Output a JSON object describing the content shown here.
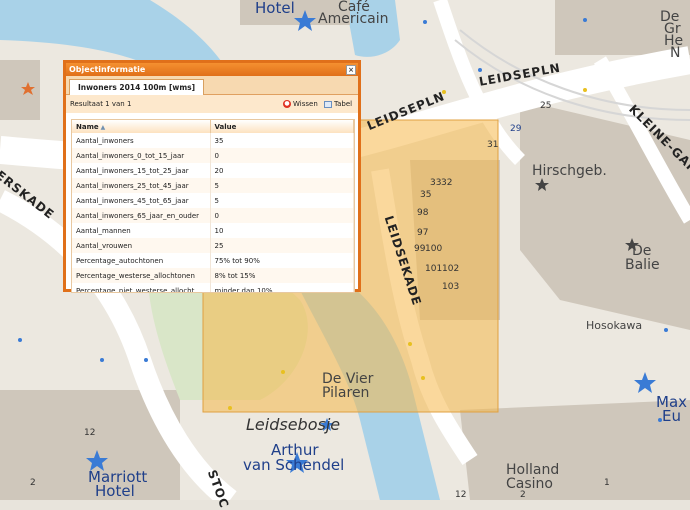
{
  "map": {
    "poi_labels": [
      {
        "key": "hotel_top",
        "text": "Hotel"
      },
      {
        "key": "cafe",
        "text": "Café"
      },
      {
        "key": "americain",
        "text": "Americain"
      },
      {
        "key": "de_groene",
        "text": "De"
      },
      {
        "key": "de_groene2",
        "text": "Gr"
      },
      {
        "key": "de_groene3",
        "text": "He"
      },
      {
        "key": "de_groene4",
        "text": "N"
      },
      {
        "key": "hirschgeb",
        "text": "Hirschgeb."
      },
      {
        "key": "de_balie1",
        "text": "De"
      },
      {
        "key": "de_balie2",
        "text": "Balie"
      },
      {
        "key": "hosokawa",
        "text": "Hosokawa"
      },
      {
        "key": "de_vier1",
        "text": "De Vier"
      },
      {
        "key": "de_vier2",
        "text": "Pilaren"
      },
      {
        "key": "arthur1",
        "text": "Arthur"
      },
      {
        "key": "arthur2",
        "text": "van Schendel"
      },
      {
        "key": "marriott1",
        "text": "Marriott"
      },
      {
        "key": "marriott2",
        "text": "Hotel"
      },
      {
        "key": "holland1",
        "text": "Holland"
      },
      {
        "key": "holland2",
        "text": "Casino"
      },
      {
        "key": "max1",
        "text": "Max"
      },
      {
        "key": "max2",
        "text": "Eu"
      }
    ],
    "street_labels": [
      {
        "key": "leidsepln1",
        "text": "LEIDSEPLN"
      },
      {
        "key": "leidsepln2",
        "text": "LEIDSEPLN"
      },
      {
        "key": "leidsekade",
        "text": "LEIDSEKADE"
      },
      {
        "key": "kleine_gartm",
        "text": "KLEINE-GARTM"
      },
      {
        "key": "erskade",
        "text": "ERSKADE"
      },
      {
        "key": "stoc",
        "text": "STOC"
      }
    ],
    "water_label": "Leidsebosje",
    "house_numbers": [
      "25",
      "29",
      "31",
      "33",
      "35",
      "32",
      "98",
      "97",
      "99",
      "100",
      "101",
      "102",
      "103",
      "12",
      "2",
      "12",
      "2",
      "1"
    ]
  },
  "dialog": {
    "title": "Objectinformatie",
    "close_glyph": "×",
    "tab_label": "Inwoners 2014 100m [wms]",
    "result_count": "Resultaat 1 van 1",
    "clear_label": "Wissen",
    "table_label": "Tabel",
    "columns": [
      "Name",
      "Value"
    ],
    "rows": [
      {
        "name": "Aantal_inwoners",
        "value": "35"
      },
      {
        "name": "Aantal_inwoners_0_tot_15_jaar",
        "value": "0"
      },
      {
        "name": "Aantal_inwoners_15_tot_25_jaar",
        "value": "20"
      },
      {
        "name": "Aantal_inwoners_25_tot_45_jaar",
        "value": "5"
      },
      {
        "name": "Aantal_inwoners_45_tot_65_jaar",
        "value": "5"
      },
      {
        "name": "Aantal_inwoners_65_jaar_en_ouder",
        "value": "0"
      },
      {
        "name": "Aantal_mannen",
        "value": "10"
      },
      {
        "name": "Aantal_vrouwen",
        "value": "25"
      },
      {
        "name": "Percentage_autochtonen",
        "value": "75% tot 90%"
      },
      {
        "name": "Percentage_westerse_allochtonen",
        "value": "8% tot 15%"
      },
      {
        "name": "Percentage_niet_westerse_allochtonen",
        "value": "minder dan 10%"
      }
    ]
  },
  "colors": {
    "accent": "#e0701a",
    "highlight": "#f6b84a",
    "water": "#a9d2e8",
    "building": "#cfc7bb",
    "road": "#ffffff"
  }
}
